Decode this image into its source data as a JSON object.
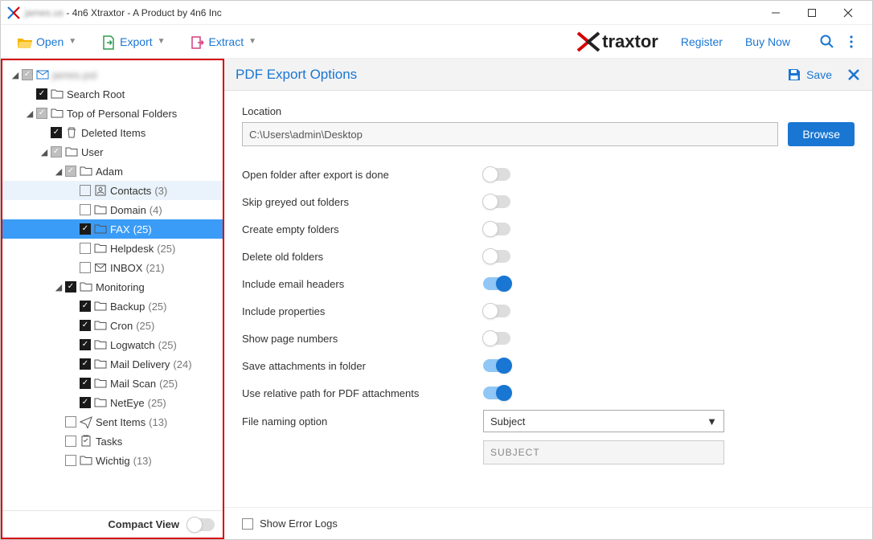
{
  "window": {
    "title_obscured": "james.us",
    "title_suffix": " - 4n6 Xtraxtor - A Product by 4n6 Inc"
  },
  "toolbar": {
    "open": "Open",
    "export": "Export",
    "extract": "Extract",
    "brand": "traxtor",
    "register": "Register",
    "buy_now": "Buy Now"
  },
  "panel": {
    "title": "PDF Export Options",
    "save": "Save"
  },
  "form": {
    "location_label": "Location",
    "location_value": "C:\\Users\\admin\\Desktop",
    "browse": "Browse",
    "naming_label": "File naming option",
    "naming_value": "Subject",
    "pattern_value": "SUBJECT"
  },
  "options": [
    {
      "label": "Open folder after export is done",
      "on": false
    },
    {
      "label": "Skip greyed out folders",
      "on": false
    },
    {
      "label": "Create empty folders",
      "on": false
    },
    {
      "label": "Delete old folders",
      "on": false
    },
    {
      "label": "Include email headers",
      "on": true
    },
    {
      "label": "Include properties",
      "on": false
    },
    {
      "label": "Show page numbers",
      "on": false
    },
    {
      "label": "Save attachments in folder",
      "on": true
    },
    {
      "label": "Use relative path for PDF attachments",
      "on": true
    }
  ],
  "footer": {
    "show_error_logs": "Show Error Logs",
    "compact_view": "Compact View"
  },
  "tree": [
    {
      "depth": 0,
      "exp": "open",
      "chk": "indet",
      "icon": "mail",
      "label": "",
      "obscured": true,
      "count": null
    },
    {
      "depth": 1,
      "exp": "none",
      "chk": "checked",
      "icon": "folder",
      "label": "Search Root",
      "count": null
    },
    {
      "depth": 1,
      "exp": "open",
      "chk": "indet",
      "icon": "folder",
      "label": "Top of Personal Folders",
      "count": null
    },
    {
      "depth": 2,
      "exp": "none",
      "chk": "checked",
      "icon": "trash",
      "label": "Deleted Items",
      "count": null
    },
    {
      "depth": 2,
      "exp": "open",
      "chk": "indet",
      "icon": "folder",
      "label": "User",
      "count": null
    },
    {
      "depth": 3,
      "exp": "open",
      "chk": "indet",
      "icon": "folder",
      "label": "Adam",
      "count": null
    },
    {
      "depth": 4,
      "exp": "none",
      "chk": "unchecked",
      "icon": "contacts",
      "label": "Contacts",
      "count": "(3)",
      "state": "hover"
    },
    {
      "depth": 4,
      "exp": "none",
      "chk": "unchecked",
      "icon": "folder",
      "label": "Domain",
      "count": "(4)"
    },
    {
      "depth": 4,
      "exp": "none",
      "chk": "checked",
      "icon": "folder",
      "label": "FAX",
      "count": "(25)",
      "state": "selected"
    },
    {
      "depth": 4,
      "exp": "none",
      "chk": "unchecked",
      "icon": "folder",
      "label": "Helpdesk",
      "count": "(25)"
    },
    {
      "depth": 4,
      "exp": "none",
      "chk": "unchecked",
      "icon": "inbox",
      "label": "INBOX",
      "count": "(21)"
    },
    {
      "depth": 3,
      "exp": "open",
      "chk": "checked",
      "icon": "folder",
      "label": "Monitoring",
      "count": null
    },
    {
      "depth": 4,
      "exp": "none",
      "chk": "checked",
      "icon": "folder",
      "label": "Backup",
      "count": "(25)"
    },
    {
      "depth": 4,
      "exp": "none",
      "chk": "checked",
      "icon": "folder",
      "label": "Cron",
      "count": "(25)"
    },
    {
      "depth": 4,
      "exp": "none",
      "chk": "checked",
      "icon": "folder",
      "label": "Logwatch",
      "count": "(25)"
    },
    {
      "depth": 4,
      "exp": "none",
      "chk": "checked",
      "icon": "folder",
      "label": "Mail Delivery",
      "count": "(24)"
    },
    {
      "depth": 4,
      "exp": "none",
      "chk": "checked",
      "icon": "folder",
      "label": "Mail Scan",
      "count": "(25)"
    },
    {
      "depth": 4,
      "exp": "none",
      "chk": "checked",
      "icon": "folder",
      "label": "NetEye",
      "count": "(25)"
    },
    {
      "depth": 3,
      "exp": "none",
      "chk": "unchecked",
      "icon": "sent",
      "label": "Sent Items",
      "count": "(13)"
    },
    {
      "depth": 3,
      "exp": "none",
      "chk": "unchecked",
      "icon": "tasks",
      "label": "Tasks",
      "count": null
    },
    {
      "depth": 3,
      "exp": "none",
      "chk": "unchecked",
      "icon": "folder",
      "label": "Wichtig",
      "count": "(13)"
    }
  ]
}
